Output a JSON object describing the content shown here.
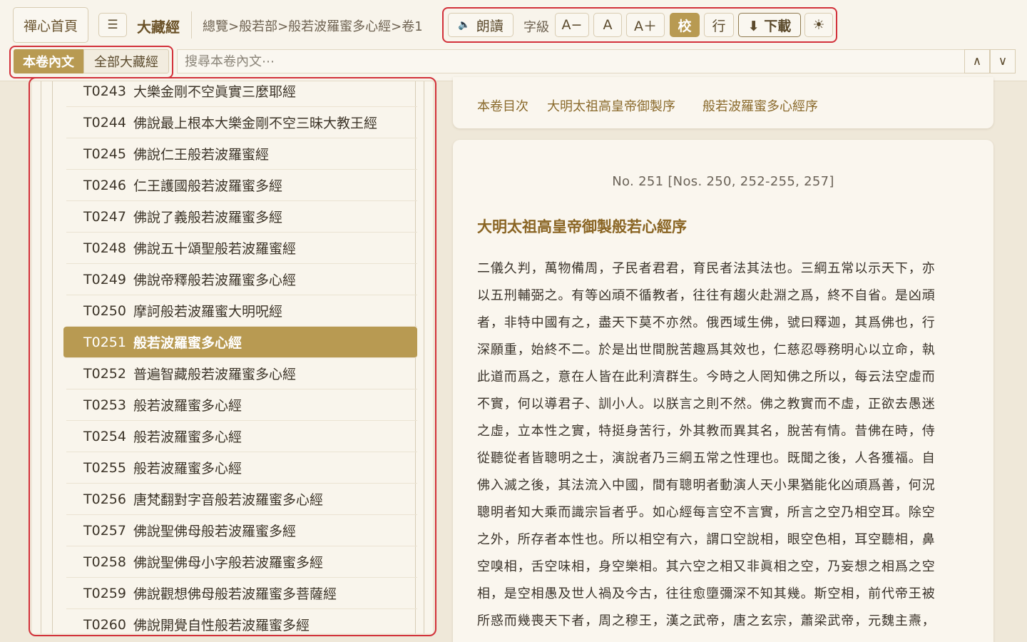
{
  "toolbar": {
    "home": "禪心首頁",
    "menu_icon": "☰",
    "title": "大藏經",
    "breadcrumb": "總覽>般若部>般若波羅蜜多心經>卷1",
    "read_aloud": "朗讀",
    "read_icon": "🔈",
    "font_size_label": "字級",
    "font_minus": "A−",
    "font_normal": "A",
    "font_plus": "A＋",
    "collate": "校",
    "line": "行",
    "download": "⬇ 下載",
    "theme_icon": "☀"
  },
  "search": {
    "scope_current": "本卷內文",
    "scope_all": "全部大藏經",
    "placeholder": "搜尋本卷內文⋯",
    "prev": "∧",
    "next": "∨"
  },
  "sutra_list": [
    {
      "code": "T0243",
      "title": "大樂金剛不空眞實三麼耶經"
    },
    {
      "code": "T0244",
      "title": "佛說最上根本大樂金剛不空三昧大教王經"
    },
    {
      "code": "T0245",
      "title": "佛說仁王般若波羅蜜經"
    },
    {
      "code": "T0246",
      "title": "仁王護國般若波羅蜜多經"
    },
    {
      "code": "T0247",
      "title": "佛說了義般若波羅蜜多經"
    },
    {
      "code": "T0248",
      "title": "佛說五十頌聖般若波羅蜜經"
    },
    {
      "code": "T0249",
      "title": "佛說帝釋般若波羅蜜多心經"
    },
    {
      "code": "T0250",
      "title": "摩訶般若波羅蜜大明呪經"
    },
    {
      "code": "T0251",
      "title": "般若波羅蜜多心經",
      "active": true
    },
    {
      "code": "T0252",
      "title": "普遍智藏般若波羅蜜多心經"
    },
    {
      "code": "T0253",
      "title": "般若波羅蜜多心經"
    },
    {
      "code": "T0254",
      "title": "般若波羅蜜多心經"
    },
    {
      "code": "T0255",
      "title": "般若波羅蜜多心經"
    },
    {
      "code": "T0256",
      "title": "唐梵翻對字音般若波羅蜜多心經"
    },
    {
      "code": "T0257",
      "title": "佛說聖佛母般若波羅蜜多經"
    },
    {
      "code": "T0258",
      "title": "佛說聖佛母小字般若波羅蜜多經"
    },
    {
      "code": "T0259",
      "title": "佛說觀想佛母般若波羅蜜多菩薩經"
    },
    {
      "code": "T0260",
      "title": "佛說開覺自性般若波羅蜜多經"
    }
  ],
  "toc": {
    "label": "本卷目次",
    "items": [
      "大明太祖高皇帝御製序",
      "般若波羅蜜多心經序"
    ]
  },
  "content": {
    "doc_no": "No. 251 [Nos. 250, 252-255, 257]",
    "title": "大明太祖高皇帝御製般若心經序",
    "lines": [
      "二儀久判，萬物備周，子民者君君，育民者法其法也。三綱五常以示天下，亦",
      "以五刑輔弼之。有等凶頑不循教者，往往有趨火赴淵之爲，終不自省。是凶頑",
      "者，非特中國有之，盡天下莫不亦然。俄西域生佛，號曰釋迦，其爲佛也，行",
      "深願重，始終不二。於是出世間脫苦趣爲其效也，仁慈忍辱務明心以立命，執",
      "此道而爲之，意在人皆在此利濟群生。今時之人罔知佛之所以，每云法空虛而",
      "不實，何以導君子、訓小人。以朕言之則不然。佛之教實而不虛，正欲去愚迷",
      "之虛，立本性之實，特挺身苦行，外其教而異其名，脫苦有情。昔佛在時，侍",
      "從聽從者皆聰明之士，演說者乃三綱五常之性理也。既聞之後，人各獲福。自",
      "佛入滅之後，其法流入中國，間有聰明者動演人天小果猶能化凶頑爲善，何況",
      "聰明者知大乘而識宗旨者乎。如心經每言空不言實，所言之空乃相空耳。除空",
      "之外，所存者本性也。所以相空有六，謂口空說相，眼空色相，耳空聽相，鼻",
      "空嗅相，舌空味相，身空樂相。其六空之相又非眞相之空，乃妄想之相爲之空",
      "相，是空相愚及世人禍及今古，往往愈墮彌深不知其幾。斯空相，前代帝王被",
      "所惑而幾喪天下者，周之穆王，漢之武帝，唐之玄宗，蕭梁武帝，元魏主燾，"
    ]
  },
  "colors": {
    "accent": "#b89a52",
    "highlight_border": "#d2313a",
    "page_background": "#efe8d9",
    "card_background": "#faf6ee"
  }
}
